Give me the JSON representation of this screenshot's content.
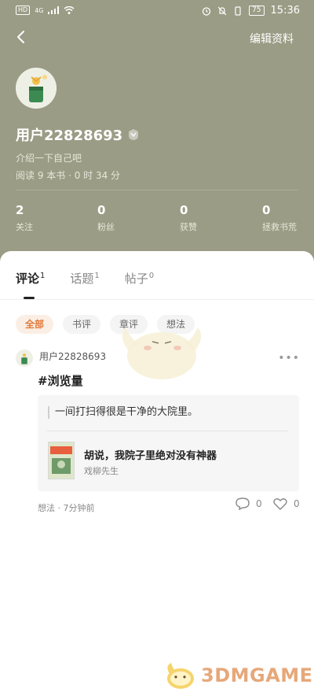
{
  "status_bar": {
    "hd": "HD",
    "network": "4G",
    "battery": "75",
    "time": "15:36"
  },
  "topbar": {
    "back_icon": "chevron-left-icon",
    "edit_label": "编辑资料"
  },
  "profile": {
    "username": "用户22828693",
    "bio": "介绍一下自己吧",
    "reading": "阅读 9 本书 · 0 时 34 分"
  },
  "stats": [
    {
      "value": "2",
      "label": "关注"
    },
    {
      "value": "0",
      "label": "粉丝"
    },
    {
      "value": "0",
      "label": "获赞"
    },
    {
      "value": "0",
      "label": "拯救书荒"
    }
  ],
  "tabs": [
    {
      "label": "评论",
      "count": "1"
    },
    {
      "label": "话题",
      "count": "1"
    },
    {
      "label": "帖子",
      "count": "0"
    }
  ],
  "filters": [
    "全部",
    "书评",
    "章评",
    "想法"
  ],
  "post": {
    "username": "用户22828693",
    "title": "#浏览量",
    "quote": "一间打扫得很是干净的大院里。",
    "book_title": "胡说，我院子里绝对没有神器",
    "book_author": "戏柳先生",
    "meta": "想法 · 7分钟前",
    "comments": "0",
    "likes": "0"
  },
  "watermark": "3DMGAME",
  "colors": {
    "header_bg": "#9a9c85",
    "accent": "#e2793a",
    "watermark": "#e6a87a"
  }
}
